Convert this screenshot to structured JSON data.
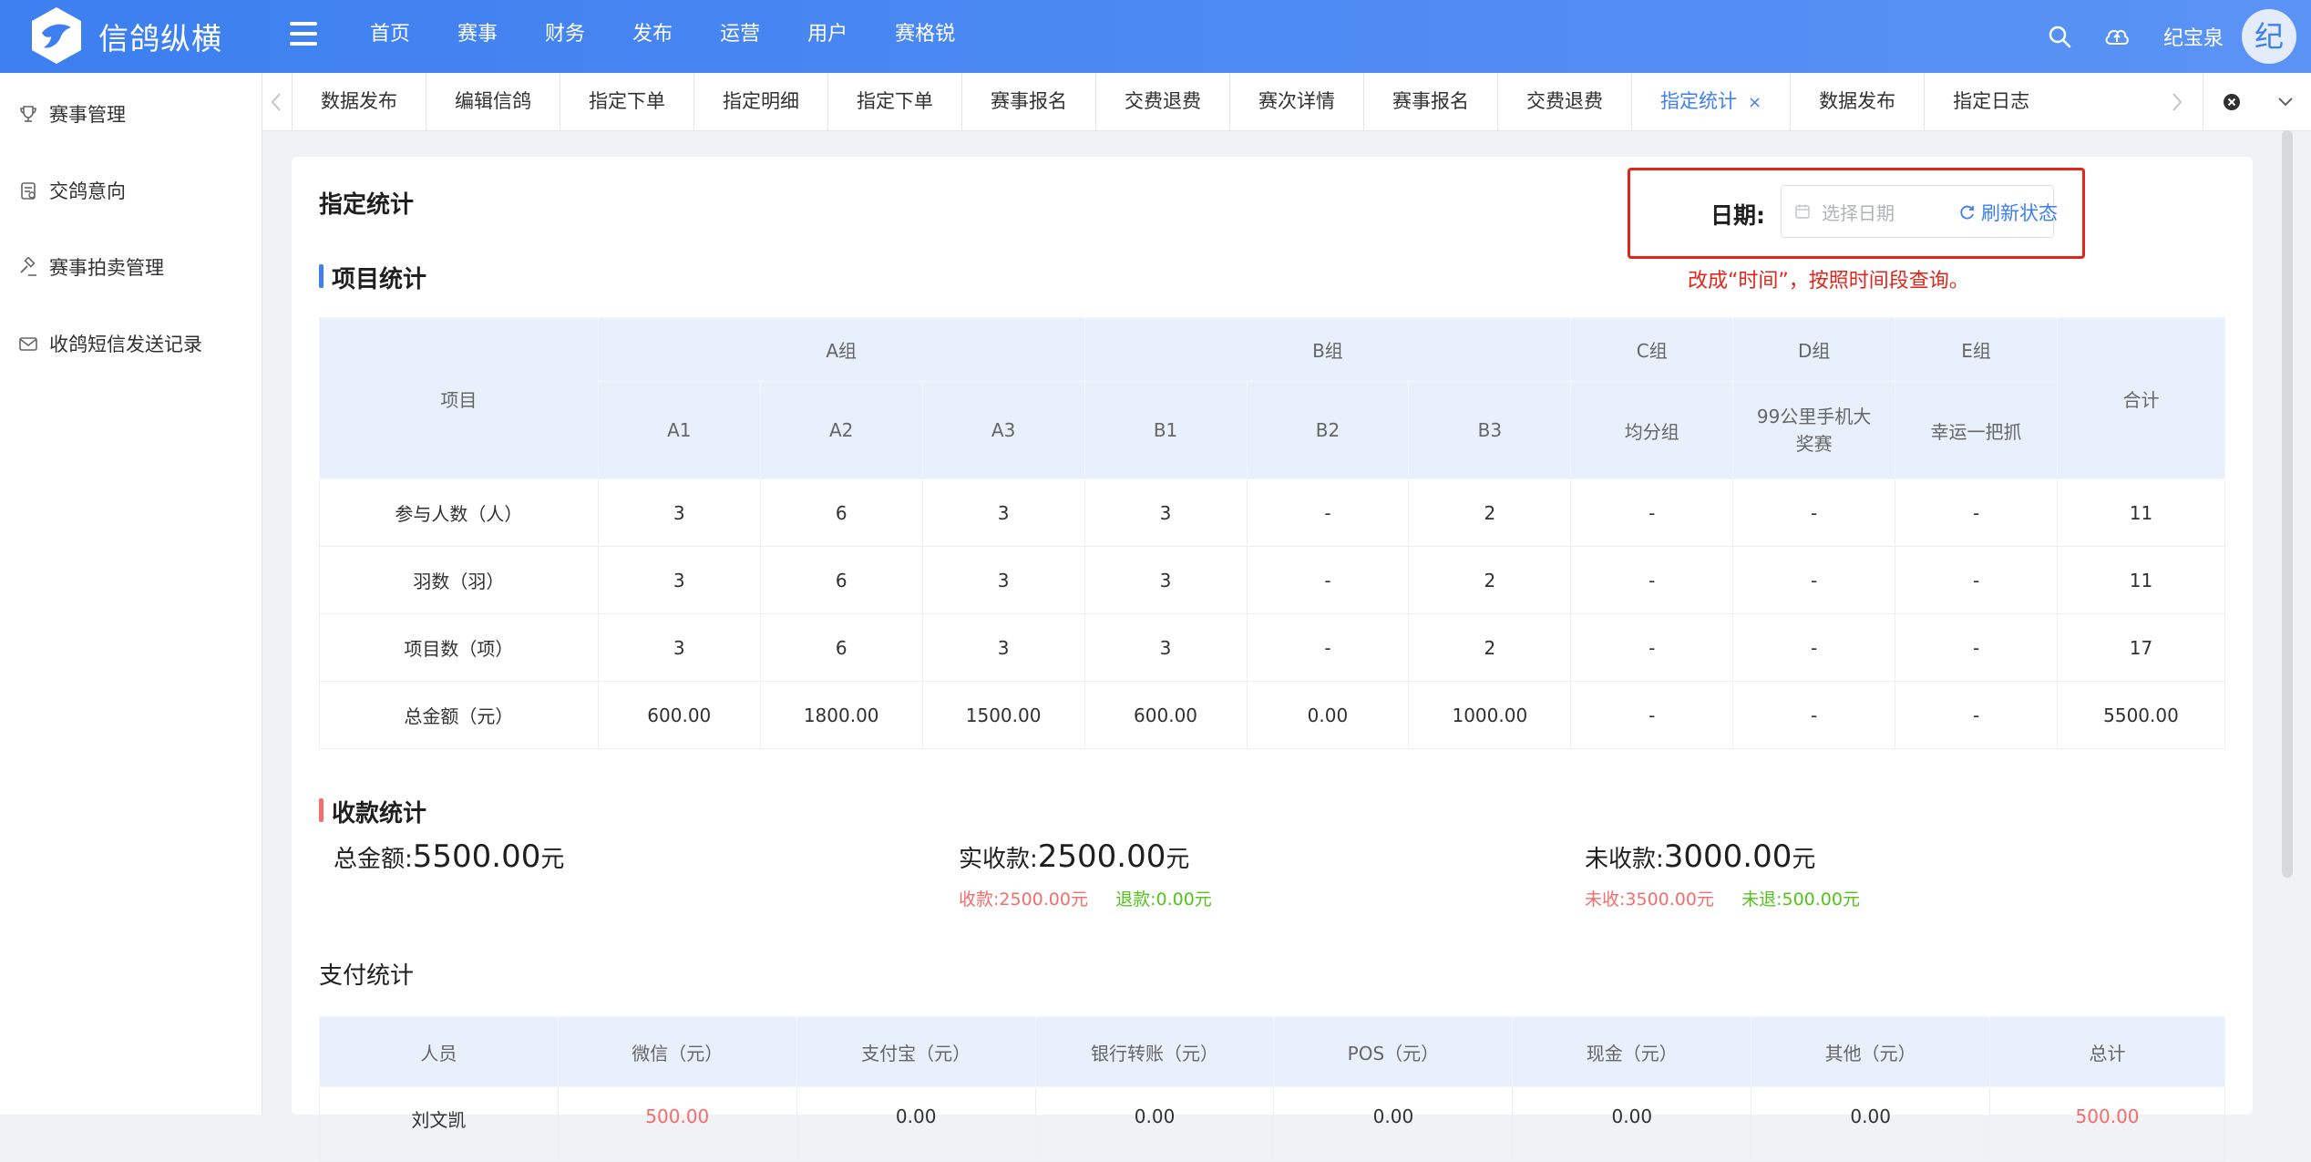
{
  "app": {
    "brand": "信鸽纵横"
  },
  "topnav": [
    "首页",
    "赛事",
    "财务",
    "发布",
    "运营",
    "用户",
    "赛格锐"
  ],
  "user": {
    "name": "纪宝泉",
    "avatar_char": "纪"
  },
  "sidebar": [
    {
      "label": "赛事管理",
      "icon": "trophy-icon"
    },
    {
      "label": "交鸽意向",
      "icon": "clipboard-icon"
    },
    {
      "label": "赛事拍卖管理",
      "icon": "gavel-icon"
    },
    {
      "label": "收鸽短信发送记录",
      "icon": "mail-icon"
    }
  ],
  "tabs": [
    {
      "label": "数据发布"
    },
    {
      "label": "编辑信鸽"
    },
    {
      "label": "指定下单"
    },
    {
      "label": "指定明细"
    },
    {
      "label": "指定下单"
    },
    {
      "label": "赛事报名"
    },
    {
      "label": "交费退费"
    },
    {
      "label": "赛次详情"
    },
    {
      "label": "赛事报名"
    },
    {
      "label": "交费退费"
    },
    {
      "label": "指定统计",
      "active": true,
      "close": "×"
    },
    {
      "label": "数据发布"
    },
    {
      "label": "指定日志"
    }
  ],
  "page": {
    "title": "指定统计",
    "date_label": "日期:",
    "date_placeholder": "选择日期",
    "annotation": "改成“时间”，按照时间段查询。",
    "refresh": "刷新状态"
  },
  "project_stats": {
    "title": "项目统计",
    "header_item": "项目",
    "header_total": "合计",
    "groups": [
      {
        "name": "A组",
        "cols": [
          "A1",
          "A2",
          "A3"
        ]
      },
      {
        "name": "B组",
        "cols": [
          "B1",
          "B2",
          "B3"
        ]
      },
      {
        "name": "C组",
        "cols": [
          "均分组"
        ]
      },
      {
        "name": "D组",
        "cols": [
          "99公里手机大奖赛"
        ]
      },
      {
        "name": "E组",
        "cols": [
          "幸运一把抓"
        ]
      }
    ],
    "rows": [
      {
        "label": "参与人数（人）",
        "values": [
          "3",
          "6",
          "3",
          "3",
          "-",
          "2",
          "-",
          "-",
          "-"
        ],
        "total": "11"
      },
      {
        "label": "羽数（羽）",
        "values": [
          "3",
          "6",
          "3",
          "3",
          "-",
          "2",
          "-",
          "-",
          "-"
        ],
        "total": "11"
      },
      {
        "label": "项目数（项）",
        "values": [
          "3",
          "6",
          "3",
          "3",
          "-",
          "2",
          "-",
          "-",
          "-"
        ],
        "total": "17"
      },
      {
        "label": "总金额（元）",
        "values": [
          "600.00",
          "1800.00",
          "1500.00",
          "600.00",
          "0.00",
          "1000.00",
          "-",
          "-",
          "-"
        ],
        "total": "5500.00"
      }
    ]
  },
  "collection": {
    "title": "收款统计",
    "total_label": "总金额:",
    "total_value": "5500.00",
    "received_label": "实收款:",
    "received_value": "2500.00",
    "received_sub1_label": "收款:",
    "received_sub1_value": "2500.00元",
    "received_sub2_label": "退款:",
    "received_sub2_value": "0.00元",
    "unreceived_label": "未收款:",
    "unreceived_value": "3000.00",
    "unreceived_sub1_label": "未收:",
    "unreceived_sub1_value": "3500.00元",
    "unreceived_sub2_label": "未退:",
    "unreceived_sub2_value": "500.00元",
    "unit": "元"
  },
  "payment": {
    "title": "支付统计",
    "headers": [
      "人员",
      "微信（元）",
      "支付宝（元）",
      "银行转账（元）",
      "POS（元）",
      "现金（元）",
      "其他（元）",
      "总计"
    ],
    "rows": [
      {
        "cells": [
          "刘文凯",
          "500.00",
          "0.00",
          "0.00",
          "0.00",
          "0.00",
          "0.00",
          "500.00"
        ]
      }
    ]
  },
  "colors": {
    "primary": "#3d7ff0",
    "danger": "#f56c6c",
    "success": "#52c41a",
    "annotation": "#e1251b"
  }
}
